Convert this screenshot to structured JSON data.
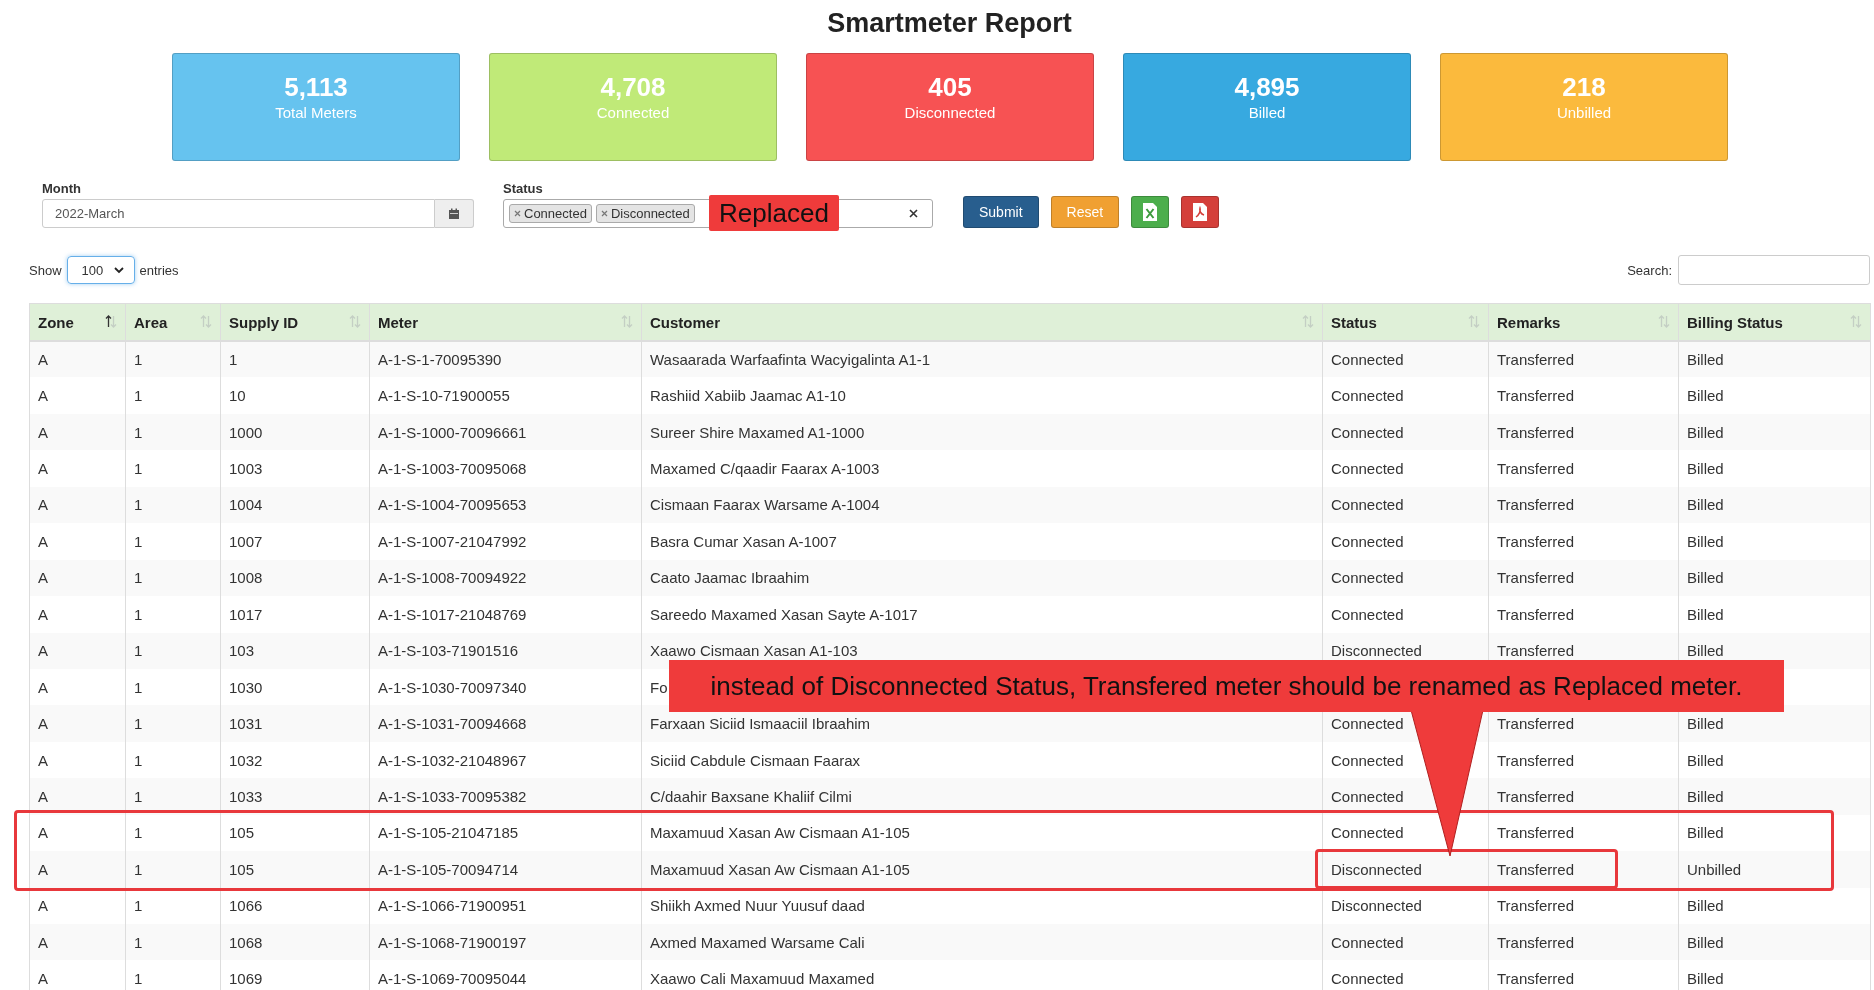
{
  "title": "Smartmeter Report",
  "cards": [
    {
      "value": "5,113",
      "label": "Total Meters",
      "color": "#66c3ef"
    },
    {
      "value": "4,708",
      "label": "Connected",
      "color": "#c0ea78"
    },
    {
      "value": "405",
      "label": "Disconnected",
      "color": "#f75253"
    },
    {
      "value": "4,895",
      "label": "Billed",
      "color": "#37a9e0"
    },
    {
      "value": "218",
      "label": "Unbilled",
      "color": "#fbba3d"
    }
  ],
  "filters": {
    "month": {
      "label": "Month",
      "value": "2022-March"
    },
    "status": {
      "label": "Status",
      "tags": [
        "Connected",
        "Disconnected"
      ]
    }
  },
  "buttons": [
    {
      "kind": "text",
      "label": "Submit",
      "color": "#285e8e"
    },
    {
      "kind": "text",
      "label": "Reset",
      "color": "#f0a032"
    },
    {
      "kind": "excel",
      "color": "#4cae4c"
    },
    {
      "kind": "pdf",
      "color": "#d43f3a"
    }
  ],
  "length": {
    "before": "Show",
    "value": "100",
    "after": "entries"
  },
  "search": {
    "label": "Search:"
  },
  "table": {
    "columns": [
      {
        "label": "Zone",
        "sorted": true
      },
      {
        "label": "Area",
        "sorted": false
      },
      {
        "label": "Supply ID",
        "sorted": false
      },
      {
        "label": "Meter",
        "sorted": false
      },
      {
        "label": "Customer",
        "sorted": false
      },
      {
        "label": "Status",
        "sorted": false
      },
      {
        "label": "Remarks",
        "sorted": false
      },
      {
        "label": "Billing Status",
        "sorted": false
      }
    ],
    "rows": [
      {
        "cells": [
          "A",
          "1",
          "1",
          "A-1-S-1-70095390",
          "Wasaarada Warfaafinta Wacyigalinta A1-1",
          "Connected",
          "Transferred",
          "Billed"
        ],
        "highlighted": false,
        "status_marked": false
      },
      {
        "cells": [
          "A",
          "1",
          "10",
          "A-1-S-10-71900055",
          "Rashiid Xabiib Jaamac A1-10",
          "Connected",
          "Transferred",
          "Billed"
        ],
        "highlighted": false,
        "status_marked": false
      },
      {
        "cells": [
          "A",
          "1",
          "1000",
          "A-1-S-1000-70096661",
          "Sureer Shire Maxamed A1-1000",
          "Connected",
          "Transferred",
          "Billed"
        ],
        "highlighted": false,
        "status_marked": false
      },
      {
        "cells": [
          "A",
          "1",
          "1003",
          "A-1-S-1003-70095068",
          "Maxamed C/qaadir Faarax A-1003",
          "Connected",
          "Transferred",
          "Billed"
        ],
        "highlighted": false,
        "status_marked": false
      },
      {
        "cells": [
          "A",
          "1",
          "1004",
          "A-1-S-1004-70095653",
          "Cismaan Faarax Warsame A-1004",
          "Connected",
          "Transferred",
          "Billed"
        ],
        "highlighted": false,
        "status_marked": false
      },
      {
        "cells": [
          "A",
          "1",
          "1007",
          "A-1-S-1007-21047992",
          "Basra Cumar Xasan A-1007",
          "Connected",
          "Transferred",
          "Billed"
        ],
        "highlighted": false,
        "status_marked": false
      },
      {
        "cells": [
          "A",
          "1",
          "1008",
          "A-1-S-1008-70094922",
          "Caato Jaamac Ibraahim",
          "Connected",
          "Transferred",
          "Billed"
        ],
        "highlighted": false,
        "status_marked": false
      },
      {
        "cells": [
          "A",
          "1",
          "1017",
          "A-1-S-1017-21048769",
          "Sareedo Maxamed Xasan Sayte A-1017",
          "Connected",
          "Transferred",
          "Billed"
        ],
        "highlighted": false,
        "status_marked": false
      },
      {
        "cells": [
          "A",
          "1",
          "103",
          "A-1-S-103-71901516",
          "Xaawo Cismaan Xasan A1-103",
          "Disconnected",
          "Transferred",
          "Billed"
        ],
        "highlighted": false,
        "status_marked": false
      },
      {
        "cells": [
          "A",
          "1",
          "1030",
          "A-1-S-1030-70097340",
          "Fo"
        ],
        "highlighted": false,
        "status_marked": false
      },
      {
        "cells": [
          "A",
          "1",
          "1031",
          "A-1-S-1031-70094668",
          "Farxaan Siciid Ismaaciil Ibraahim",
          "Connected",
          "Transferred",
          "Billed"
        ],
        "highlighted": false,
        "status_marked": false
      },
      {
        "cells": [
          "A",
          "1",
          "1032",
          "A-1-S-1032-21048967",
          "Siciid Cabdule Cismaan Faarax",
          "Connected",
          "Transferred",
          "Billed"
        ],
        "highlighted": false,
        "status_marked": false
      },
      {
        "cells": [
          "A",
          "1",
          "1033",
          "A-1-S-1033-70095382",
          "C/daahir Baxsane Khaliif Cilmi",
          "Connected",
          "Transferred",
          "Billed"
        ],
        "highlighted": false,
        "status_marked": false
      },
      {
        "cells": [
          "A",
          "1",
          "105",
          "A-1-S-105-21047185",
          "Maxamuud Xasan Aw Cismaan A1-105",
          "Connected",
          "Transferred",
          "Billed"
        ],
        "highlighted": true,
        "status_marked": false
      },
      {
        "cells": [
          "A",
          "1",
          "105",
          "A-1-S-105-70094714",
          "Maxamuud Xasan Aw Cismaan A1-105",
          "Disconnected",
          "Transferred",
          "Unbilled"
        ],
        "highlighted": true,
        "status_marked": true
      },
      {
        "cells": [
          "A",
          "1",
          "1066",
          "A-1-S-1066-71900951",
          "Shiikh Axmed Nuur Yuusuf daad",
          "Disconnected",
          "Transferred",
          "Billed"
        ],
        "highlighted": false,
        "status_marked": false
      },
      {
        "cells": [
          "A",
          "1",
          "1068",
          "A-1-S-1068-71900197",
          "Axmed Maxamed Warsame Cali",
          "Connected",
          "Transferred",
          "Billed"
        ],
        "highlighted": false,
        "status_marked": false
      },
      {
        "cells": [
          "A",
          "1",
          "1069",
          "A-1-S-1069-70095044",
          "Xaawo Cali Maxamuud Maxamed",
          "Connected",
          "Transferred",
          "Billed"
        ],
        "highlighted": false,
        "status_marked": false
      }
    ]
  },
  "annotations": {
    "tag_note": "Replaced",
    "callout": "instead of Disconnected Status, Transfered meter should be renamed as Replaced meter."
  }
}
